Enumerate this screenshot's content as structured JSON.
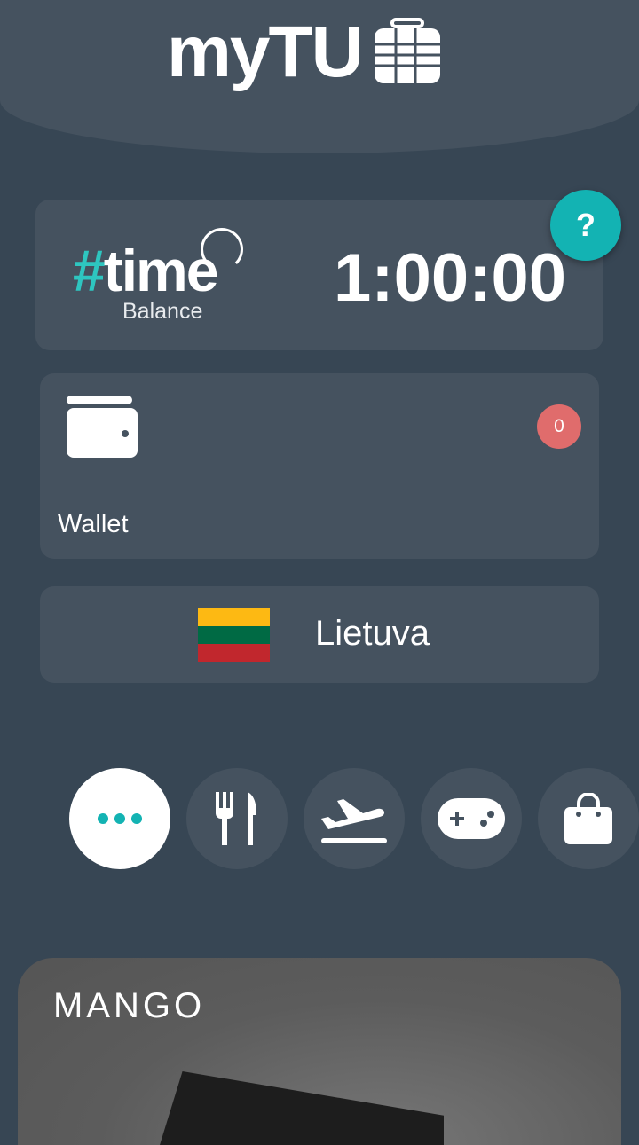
{
  "header": {
    "logo_text": "myTU"
  },
  "time_card": {
    "hash": "#",
    "word": "time",
    "label": "Balance",
    "value": "1:00:00"
  },
  "help": {
    "label": "?",
    "color": "#13b3b3"
  },
  "wallet": {
    "label": "Wallet",
    "badge": "0",
    "badge_color": "#e06c6c"
  },
  "country": {
    "name": "Lietuva",
    "flag_colors": [
      "#fdb913",
      "#006a44",
      "#c1272d"
    ]
  },
  "categories": [
    {
      "icon": "more-icon",
      "active": true
    },
    {
      "icon": "restaurant-icon",
      "active": false
    },
    {
      "icon": "flight-icon",
      "active": false
    },
    {
      "icon": "gamepad-icon",
      "active": false
    },
    {
      "icon": "shopping-bag-icon",
      "active": false
    }
  ],
  "promo": {
    "brand": "MANGO"
  }
}
